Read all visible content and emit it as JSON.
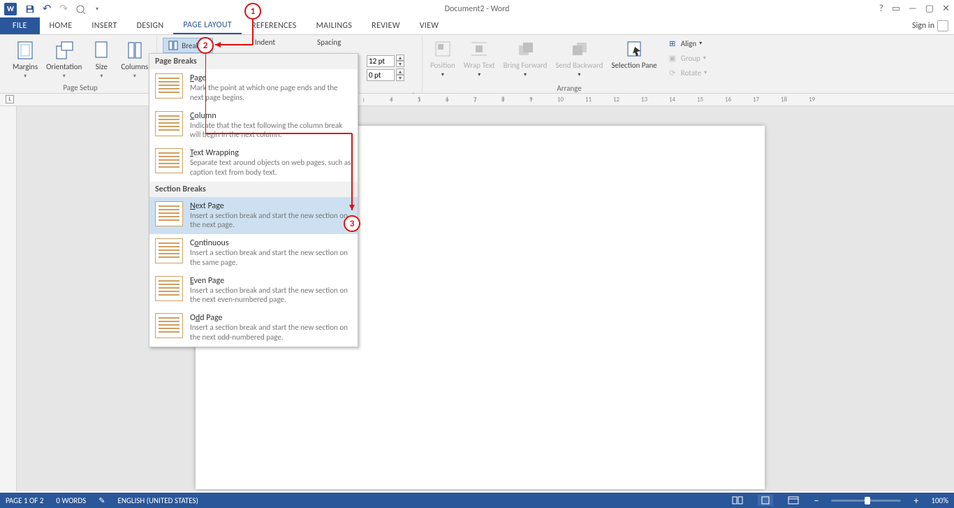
{
  "title": "Document2 - Word",
  "quick_access": {
    "undo": "↶",
    "redo": "↷"
  },
  "window_controls": {
    "help": "?",
    "ribbon": "▭",
    "min": "—",
    "max": "▢",
    "close": "✕"
  },
  "tabs": {
    "file": "FILE",
    "home": "HOME",
    "insert": "INSERT",
    "design": "DESIGN",
    "page_layout": "PAGE LAYOUT",
    "references": "REFERENCES",
    "mailings": "MAILINGS",
    "review": "REVIEW",
    "view": "VIEW",
    "signin": "Sign in"
  },
  "ribbon": {
    "page_setup": {
      "label": "Page Setup",
      "margins": "Margins",
      "orientation": "Orientation",
      "size": "Size",
      "columns": "Columns",
      "breaks": "Breaks",
      "indent": "Indent"
    },
    "spacing": {
      "label": "Spacing",
      "before": "12 pt",
      "after": "0 pt"
    },
    "arrange": {
      "label": "Arrange",
      "position": "Position",
      "wrap": "Wrap Text",
      "forward": "Bring Forward",
      "backward": "Send Backward",
      "pane": "Selection Pane",
      "align": "Align",
      "group": "Group",
      "rotate": "Rotate"
    }
  },
  "breaks_menu": {
    "page_breaks": "Page Breaks",
    "section_breaks": "Section Breaks",
    "items": {
      "page": {
        "t": "Page",
        "d": "Mark the point at which one page ends and the next page begins."
      },
      "column": {
        "t": "Column",
        "d": "Indicate that the text following the column break will begin in the next column."
      },
      "textwrap": {
        "t": "Text Wrapping",
        "d": "Separate text around objects on web pages, such as caption text from body text."
      },
      "nextpage": {
        "t": "Next Page",
        "d": "Insert a section break and start the new section on the next page."
      },
      "continuous": {
        "t": "Continuous",
        "d": "Insert a section break and start the new section on the same page."
      },
      "evenpage": {
        "t": "Even Page",
        "d": "Insert a section break and start the new section on the next even-numbered page."
      },
      "oddpage": {
        "t": "Odd Page",
        "d": "Insert a section break and start the new section on the next odd-numbered page."
      }
    }
  },
  "status": {
    "page": "PAGE 1 OF 2",
    "words": "0 WORDS",
    "lang": "ENGLISH (UNITED STATES)",
    "zoom": "100%"
  },
  "callouts": {
    "c1": "1",
    "c2": "2",
    "c3": "3"
  }
}
